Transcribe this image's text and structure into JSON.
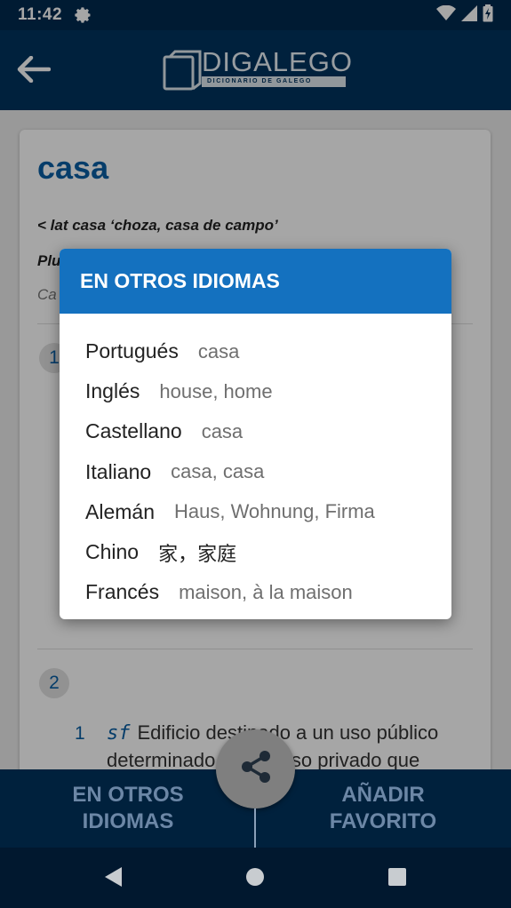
{
  "status_bar": {
    "time": "11:42",
    "icons": [
      "gear-icon",
      "wifi-icon",
      "signal-icon",
      "battery-icon"
    ]
  },
  "header": {
    "logo_title": "DIGALEGO",
    "logo_subtitle": "DICIONARIO DE GALEGO",
    "back_icon": "arrow-left-icon"
  },
  "entry": {
    "word": "casa",
    "etymology": "< lat casa ‘choza, casa de campo’",
    "plural_prefix": "Plu",
    "cas_prefix": "Ca",
    "sections": [
      "1",
      "2"
    ],
    "definition": {
      "number": "1",
      "type": "sf",
      "text": "Edificio destinado a un uso público determinado o a un uso privado que"
    }
  },
  "dialog": {
    "title": "EN OTROS IDIOMAS",
    "languages": [
      {
        "name": "Portugués",
        "translation": "casa"
      },
      {
        "name": "Inglés",
        "translation": "house, home"
      },
      {
        "name": "Castellano",
        "translation": "casa"
      },
      {
        "name": "Italiano",
        "translation": "casa, casa"
      },
      {
        "name": "Alemán",
        "translation": "Haus, Wohnung, Firma"
      },
      {
        "name": "Chino",
        "translation": "家，家庭"
      },
      {
        "name": "Francés",
        "translation": "maison, à la maison"
      }
    ]
  },
  "action_bar": {
    "left_label": "EN OTROS IDIOMAS",
    "right_label": "AÑADIR FAVORITO",
    "fab_icon": "share-icon"
  },
  "colors": {
    "header_bg": "#00335e",
    "accent": "#1471bf",
    "word_color": "#0a5fa4"
  }
}
